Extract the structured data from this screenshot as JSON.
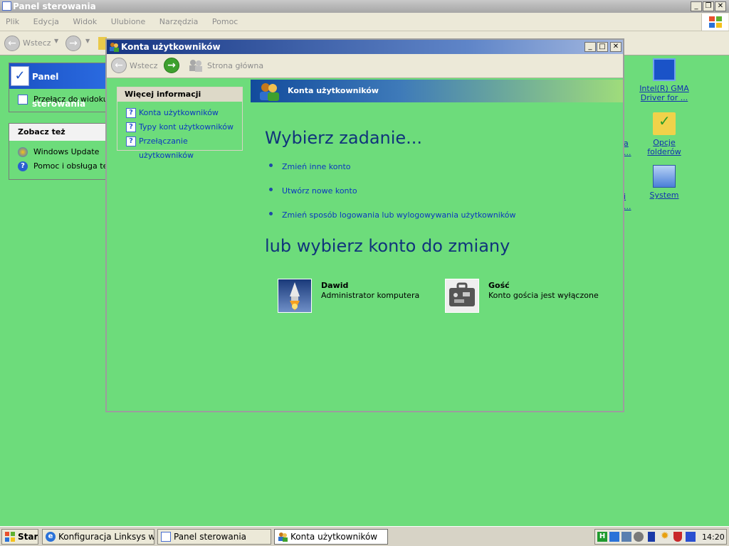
{
  "background_window": {
    "title": "Panel sterowania",
    "menu": [
      "Plik",
      "Edycja",
      "Widok",
      "Ulubione",
      "Narzędzia",
      "Pomoc"
    ],
    "toolbar": {
      "back_label": "Wstecz"
    },
    "panel_box": {
      "title": "Panel sterowania",
      "link": "Przełącz do widoku k"
    },
    "see_also": {
      "title": "Zobacz też",
      "links": [
        "Windows Update",
        "Pomoc i obsługa tech"
      ]
    }
  },
  "desktop_icons": [
    {
      "label": "Intel(R) GMA Driver for ..."
    },
    {
      "label": "Opcje folderów"
    },
    {
      "label": "System"
    }
  ],
  "desktop_partial_labels": [
    "a",
    "...",
    "i",
    "..."
  ],
  "window": {
    "title": "Konta użytkowników",
    "toolbar": {
      "back_label": "Wstecz",
      "home_label": "Strona główna"
    },
    "sidebar": {
      "title": "Więcej informacji",
      "links": [
        "Konta użytkowników",
        "Typy kont użytkowników",
        "Przełączanie użytkowników"
      ]
    },
    "header": "Konta użytkowników",
    "heading_tasks": "Wybierz zadanie...",
    "tasks": [
      "Zmień inne konto",
      "Utwórz nowe konto",
      "Zmień sposób logowania lub wylogowywania użytkowników"
    ],
    "heading_accounts": "lub wybierz konto do zmiany",
    "accounts": [
      {
        "name": "Dawid",
        "desc": "Administrator komputera"
      },
      {
        "name": "Gość",
        "desc": "Konto gościa jest wyłączone"
      }
    ]
  },
  "taskbar": {
    "start": "Start",
    "buttons": [
      "Konfiguracja Linksys wrt...",
      "Panel sterowania",
      "Konta użytkowników"
    ],
    "clock": "14:20"
  }
}
